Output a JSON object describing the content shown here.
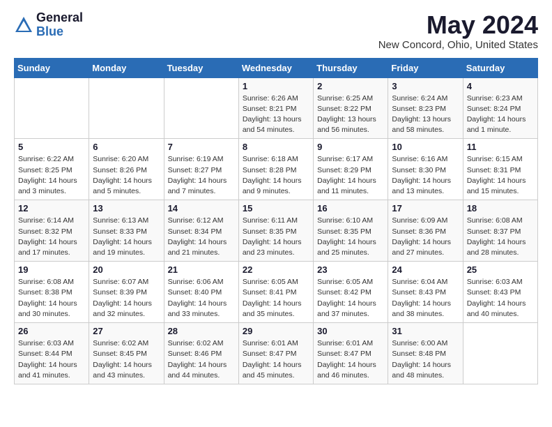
{
  "logo": {
    "general": "General",
    "blue": "Blue"
  },
  "title": "May 2024",
  "location": "New Concord, Ohio, United States",
  "days_of_week": [
    "Sunday",
    "Monday",
    "Tuesday",
    "Wednesday",
    "Thursday",
    "Friday",
    "Saturday"
  ],
  "weeks": [
    [
      {
        "day": "",
        "info": ""
      },
      {
        "day": "",
        "info": ""
      },
      {
        "day": "",
        "info": ""
      },
      {
        "day": "1",
        "info": "Sunrise: 6:26 AM\nSunset: 8:21 PM\nDaylight: 13 hours\nand 54 minutes."
      },
      {
        "day": "2",
        "info": "Sunrise: 6:25 AM\nSunset: 8:22 PM\nDaylight: 13 hours\nand 56 minutes."
      },
      {
        "day": "3",
        "info": "Sunrise: 6:24 AM\nSunset: 8:23 PM\nDaylight: 13 hours\nand 58 minutes."
      },
      {
        "day": "4",
        "info": "Sunrise: 6:23 AM\nSunset: 8:24 PM\nDaylight: 14 hours\nand 1 minute."
      }
    ],
    [
      {
        "day": "5",
        "info": "Sunrise: 6:22 AM\nSunset: 8:25 PM\nDaylight: 14 hours\nand 3 minutes."
      },
      {
        "day": "6",
        "info": "Sunrise: 6:20 AM\nSunset: 8:26 PM\nDaylight: 14 hours\nand 5 minutes."
      },
      {
        "day": "7",
        "info": "Sunrise: 6:19 AM\nSunset: 8:27 PM\nDaylight: 14 hours\nand 7 minutes."
      },
      {
        "day": "8",
        "info": "Sunrise: 6:18 AM\nSunset: 8:28 PM\nDaylight: 14 hours\nand 9 minutes."
      },
      {
        "day": "9",
        "info": "Sunrise: 6:17 AM\nSunset: 8:29 PM\nDaylight: 14 hours\nand 11 minutes."
      },
      {
        "day": "10",
        "info": "Sunrise: 6:16 AM\nSunset: 8:30 PM\nDaylight: 14 hours\nand 13 minutes."
      },
      {
        "day": "11",
        "info": "Sunrise: 6:15 AM\nSunset: 8:31 PM\nDaylight: 14 hours\nand 15 minutes."
      }
    ],
    [
      {
        "day": "12",
        "info": "Sunrise: 6:14 AM\nSunset: 8:32 PM\nDaylight: 14 hours\nand 17 minutes."
      },
      {
        "day": "13",
        "info": "Sunrise: 6:13 AM\nSunset: 8:33 PM\nDaylight: 14 hours\nand 19 minutes."
      },
      {
        "day": "14",
        "info": "Sunrise: 6:12 AM\nSunset: 8:34 PM\nDaylight: 14 hours\nand 21 minutes."
      },
      {
        "day": "15",
        "info": "Sunrise: 6:11 AM\nSunset: 8:35 PM\nDaylight: 14 hours\nand 23 minutes."
      },
      {
        "day": "16",
        "info": "Sunrise: 6:10 AM\nSunset: 8:35 PM\nDaylight: 14 hours\nand 25 minutes."
      },
      {
        "day": "17",
        "info": "Sunrise: 6:09 AM\nSunset: 8:36 PM\nDaylight: 14 hours\nand 27 minutes."
      },
      {
        "day": "18",
        "info": "Sunrise: 6:08 AM\nSunset: 8:37 PM\nDaylight: 14 hours\nand 28 minutes."
      }
    ],
    [
      {
        "day": "19",
        "info": "Sunrise: 6:08 AM\nSunset: 8:38 PM\nDaylight: 14 hours\nand 30 minutes."
      },
      {
        "day": "20",
        "info": "Sunrise: 6:07 AM\nSunset: 8:39 PM\nDaylight: 14 hours\nand 32 minutes."
      },
      {
        "day": "21",
        "info": "Sunrise: 6:06 AM\nSunset: 8:40 PM\nDaylight: 14 hours\nand 33 minutes."
      },
      {
        "day": "22",
        "info": "Sunrise: 6:05 AM\nSunset: 8:41 PM\nDaylight: 14 hours\nand 35 minutes."
      },
      {
        "day": "23",
        "info": "Sunrise: 6:05 AM\nSunset: 8:42 PM\nDaylight: 14 hours\nand 37 minutes."
      },
      {
        "day": "24",
        "info": "Sunrise: 6:04 AM\nSunset: 8:43 PM\nDaylight: 14 hours\nand 38 minutes."
      },
      {
        "day": "25",
        "info": "Sunrise: 6:03 AM\nSunset: 8:43 PM\nDaylight: 14 hours\nand 40 minutes."
      }
    ],
    [
      {
        "day": "26",
        "info": "Sunrise: 6:03 AM\nSunset: 8:44 PM\nDaylight: 14 hours\nand 41 minutes."
      },
      {
        "day": "27",
        "info": "Sunrise: 6:02 AM\nSunset: 8:45 PM\nDaylight: 14 hours\nand 43 minutes."
      },
      {
        "day": "28",
        "info": "Sunrise: 6:02 AM\nSunset: 8:46 PM\nDaylight: 14 hours\nand 44 minutes."
      },
      {
        "day": "29",
        "info": "Sunrise: 6:01 AM\nSunset: 8:47 PM\nDaylight: 14 hours\nand 45 minutes."
      },
      {
        "day": "30",
        "info": "Sunrise: 6:01 AM\nSunset: 8:47 PM\nDaylight: 14 hours\nand 46 minutes."
      },
      {
        "day": "31",
        "info": "Sunrise: 6:00 AM\nSunset: 8:48 PM\nDaylight: 14 hours\nand 48 minutes."
      },
      {
        "day": "",
        "info": ""
      }
    ]
  ]
}
